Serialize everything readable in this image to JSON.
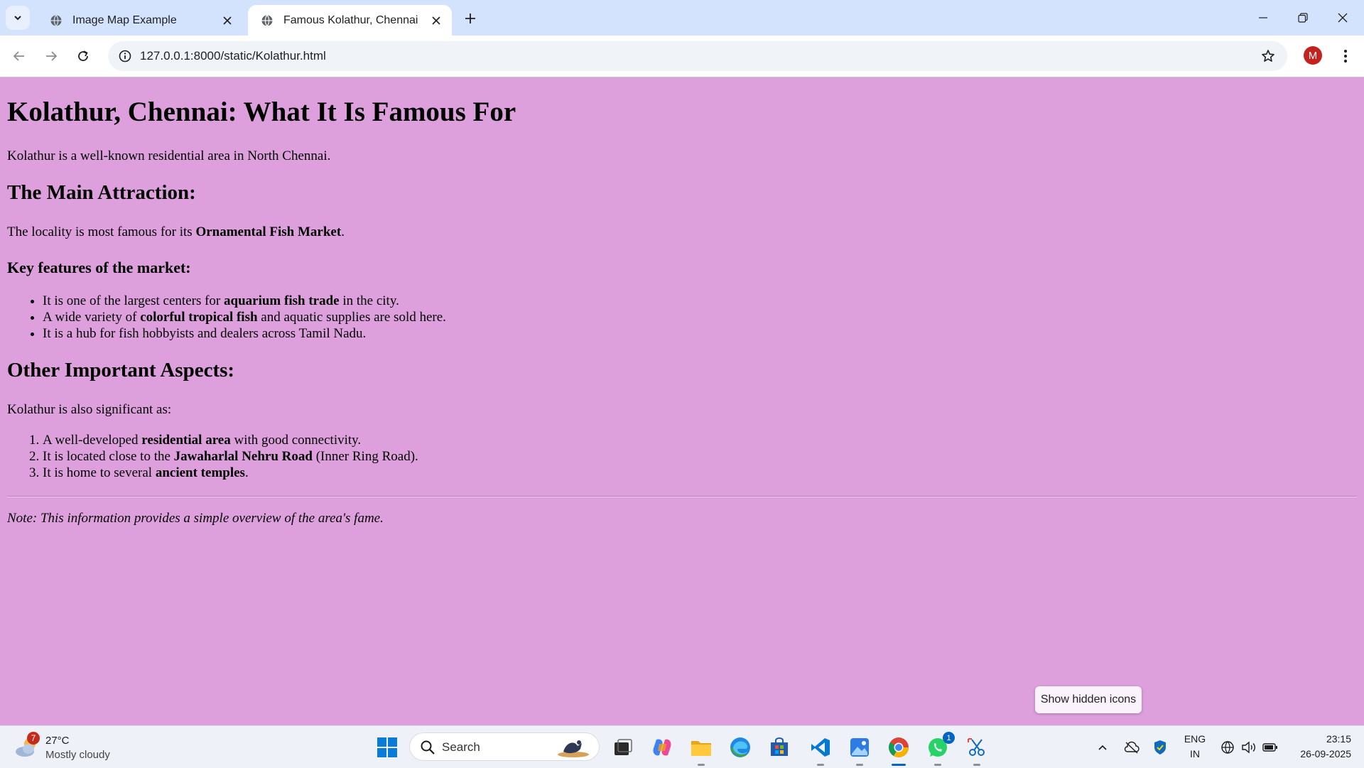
{
  "browser": {
    "tabs": [
      {
        "title": "Image Map Example",
        "active": false
      },
      {
        "title": "Famous Kolathur, Chennai",
        "active": true
      }
    ],
    "url": "127.0.0.1:8000/static/Kolathur.html",
    "profile_initial": "M"
  },
  "page": {
    "title": "Kolathur, Chennai: What It Is Famous For",
    "intro": "Kolathur is a well-known residential area in North Chennai.",
    "main_attraction": {
      "heading": "The Main Attraction:",
      "text_before": "The locality is most famous for its ",
      "text_bold": "Ornamental Fish Market",
      "text_after": "."
    },
    "key_features": {
      "heading": "Key features of the market:",
      "items": [
        {
          "before": "It is one of the largest centers for ",
          "bold": "aquarium fish trade",
          "after": " in the city."
        },
        {
          "before": "A wide variety of ",
          "bold": "colorful tropical fish",
          "after": " and aquatic supplies are sold here."
        },
        {
          "before": "It is a hub for fish hobbyists and dealers across Tamil Nadu.",
          "bold": "",
          "after": ""
        }
      ]
    },
    "other_aspects": {
      "heading": "Other Important Aspects:",
      "intro": "Kolathur is also significant as:",
      "items": [
        {
          "before": "A well-developed ",
          "bold": "residential area",
          "after": " with good connectivity."
        },
        {
          "before": "It is located close to the ",
          "bold": "Jawaharlal Nehru Road",
          "after": " (Inner Ring Road)."
        },
        {
          "before": "It is home to several ",
          "bold": "ancient temples",
          "after": "."
        }
      ]
    },
    "note": "Note: This information provides a simple overview of the area's fame."
  },
  "tooltip": "Show hidden icons",
  "taskbar": {
    "weather": {
      "badge": "7",
      "temp": "27°C",
      "condition": "Mostly cloudy"
    },
    "search_label": "Search",
    "whatsapp_badge": "1",
    "language": {
      "line1": "ENG",
      "line2": "IN"
    },
    "clock": {
      "time": "23:15",
      "date": "26-09-2025"
    }
  },
  "colors": {
    "page_background": "#dda0dd",
    "tabbar": "#d3e3fd",
    "taskbar": "#eef1f7"
  }
}
